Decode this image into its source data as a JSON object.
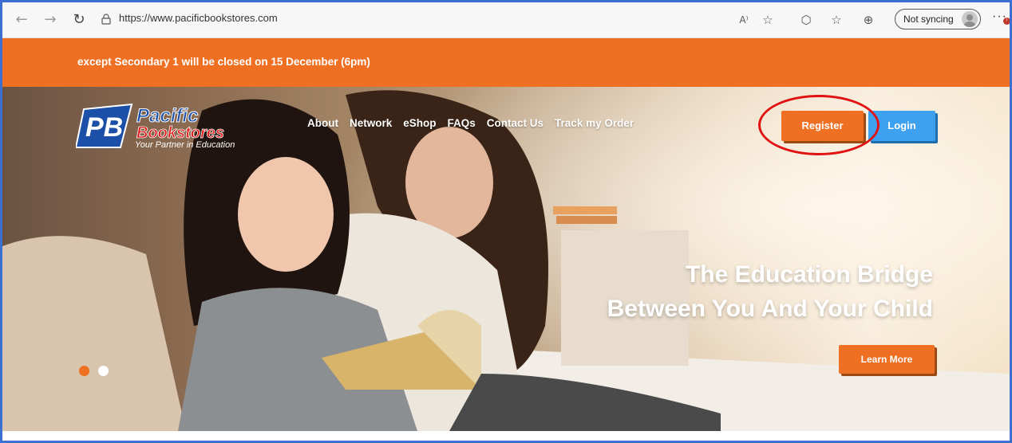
{
  "browser": {
    "url": "https://www.pacificbookstores.com",
    "sync_label": "Not syncing",
    "more_label": "···",
    "notif_badge": "!"
  },
  "announcement": {
    "text": "except Secondary 1 will be closed on 15 December (6pm)"
  },
  "logo": {
    "line1": "Pacific",
    "line2": "Bookstores",
    "tagline": "Your Partner in Education",
    "mark": "PB"
  },
  "nav": {
    "items": [
      "About",
      "Network",
      "eShop",
      "FAQs",
      "Contact Us",
      "Track my Order"
    ]
  },
  "auth": {
    "register_label": "Register",
    "login_label": "Login"
  },
  "hero": {
    "title_line1": "The Education Bridge",
    "title_line2": "Between You And Your Child",
    "cta_label": "Learn More"
  },
  "colors": {
    "accent_orange": "#f07023",
    "login_blue": "#3ea1f0",
    "highlight_red": "#e01212",
    "dot_active": "#f07023",
    "dot_inactive": "#ffffff"
  }
}
